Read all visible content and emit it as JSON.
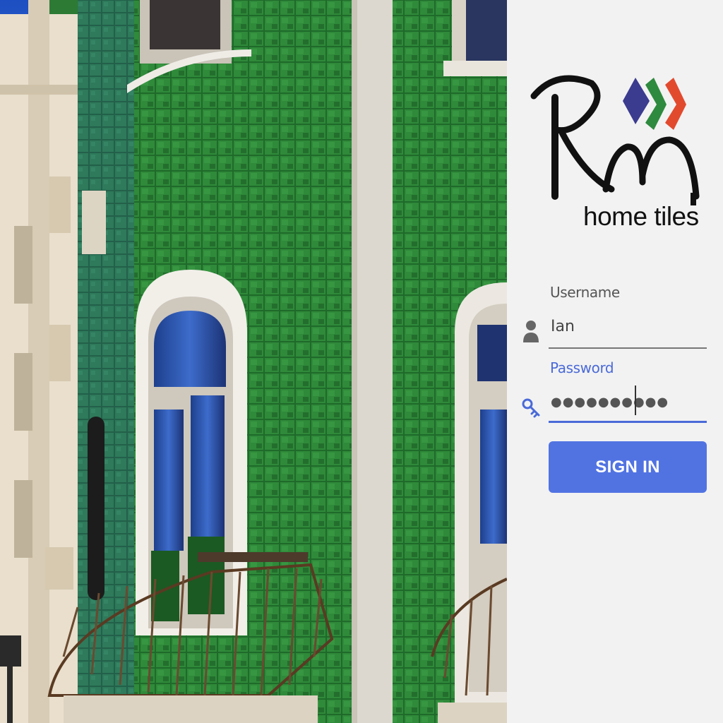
{
  "brand": {
    "logo_letters": "Rm",
    "subtitle": "home tiles",
    "chevron_colors": [
      "#3b3b8f",
      "#2e8a3e",
      "#e24a2e"
    ]
  },
  "login": {
    "username": {
      "label": "Username",
      "value": "Ian",
      "icon": "user-icon"
    },
    "password": {
      "label": "Password",
      "masked_value": "●●●●●●●●●●",
      "icon": "key-icon"
    },
    "signin_label": "SIGN IN"
  },
  "colors": {
    "accent": "#5173e2",
    "focus": "#4a6ad8",
    "panel_bg": "#f2f2f3",
    "tile_green": "#2d7a34"
  }
}
